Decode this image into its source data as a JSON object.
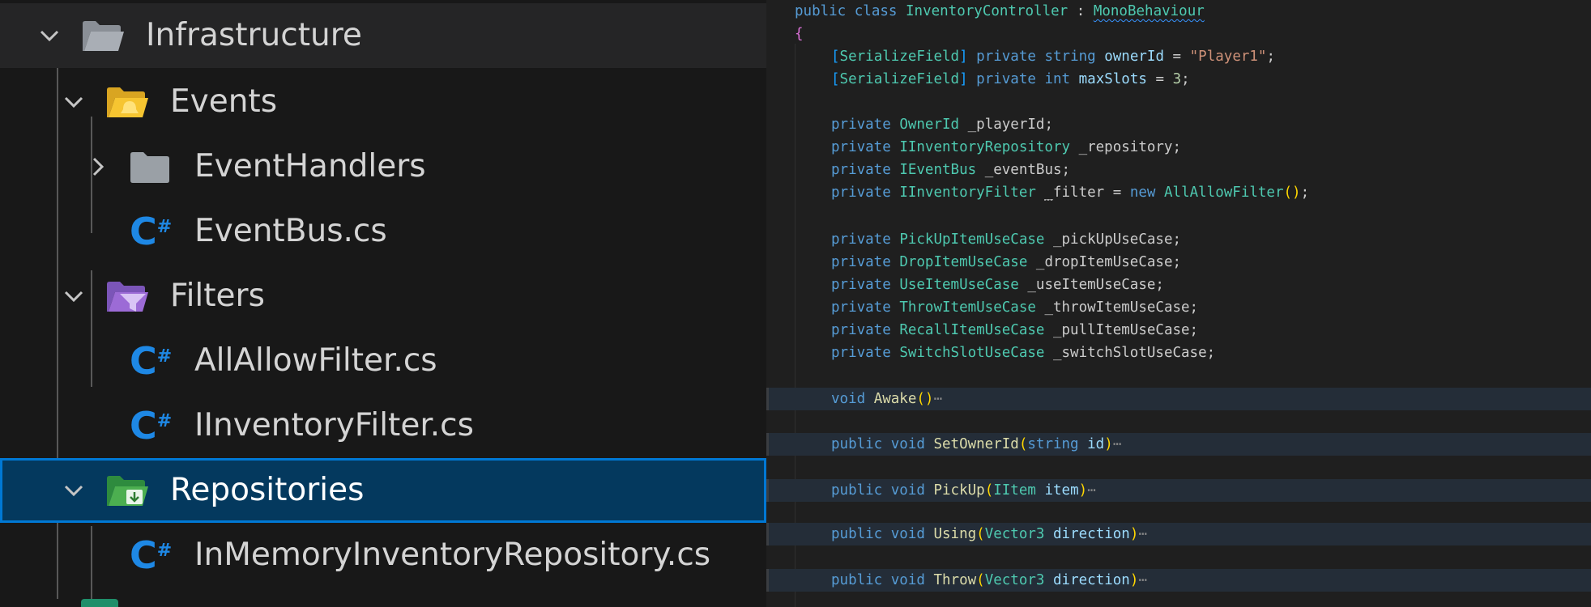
{
  "explorer": {
    "infrastructure": "Infrastructure",
    "events": "Events",
    "event_handlers": "EventHandlers",
    "event_bus": "EventBus.cs",
    "filters": "Filters",
    "all_allow_filter": "AllAllowFilter.cs",
    "iinventory_filter": "IInventoryFilter.cs",
    "repositories": "Repositories",
    "in_memory_repo": "InMemoryInventoryRepository.cs",
    "cs_glyph": "C",
    "cs_hash": "#"
  },
  "editor": {
    "l1": {
      "kw1": "public",
      "kw2": "class",
      "name": "InventoryController",
      "colon": ":",
      "base": "MonoBehaviour"
    },
    "l2": {
      "brace": "{"
    },
    "l3": {
      "b1": "[",
      "attr": "SerializeField",
      "b2": "]",
      "kw": "private",
      "type": "string",
      "name": "ownerId",
      "eq": "=",
      "val": "\"Player1\"",
      "semi": ";"
    },
    "l4": {
      "b1": "[",
      "attr": "SerializeField",
      "b2": "]",
      "kw": "private",
      "type": "int",
      "name": "maxSlots",
      "eq": "=",
      "val": "3",
      "semi": ";"
    },
    "l6": {
      "kw": "private",
      "type": "OwnerId",
      "name": "_playerId;"
    },
    "l7": {
      "kw": "private",
      "type": "IInventoryRepository",
      "name": "_repository;"
    },
    "l8": {
      "kw": "private",
      "type": "IEventBus",
      "name": "_eventBus;"
    },
    "l9": {
      "kw": "private",
      "type": "IInventoryFilter",
      "u": "_",
      "name": "filter",
      "eq": "=",
      "kw2": "new",
      "ctor": "AllAllowFilter",
      "paren": "()",
      "semi": ";"
    },
    "l11": {
      "kw": "private",
      "type": "PickUpItemUseCase",
      "name": "_pickUpUseCase;"
    },
    "l12": {
      "kw": "private",
      "type": "DropItemUseCase",
      "name": "_dropItemUseCase;"
    },
    "l13": {
      "kw": "private",
      "type": "UseItemUseCase",
      "name": "_useItemUseCase;"
    },
    "l14": {
      "kw": "private",
      "type": "ThrowItemUseCase",
      "name": "_throwItemUseCase;"
    },
    "l15": {
      "kw": "private",
      "type": "RecallItemUseCase",
      "name": "_pullItemUseCase;"
    },
    "l16": {
      "kw": "private",
      "type": "SwitchSlotUseCase",
      "name": "_switchSlotUseCase;"
    },
    "m1": {
      "kw": "void",
      "fn": "Awake",
      "paren": "()",
      "ell": "⋯"
    },
    "m2": {
      "kw1": "public",
      "kw2": "void",
      "fn": "SetOwnerId",
      "po": "(",
      "ptype": "string",
      "pname": "id",
      "pc": ")",
      "ell": "⋯"
    },
    "m3": {
      "kw1": "public",
      "kw2": "void",
      "fn": "PickUp",
      "po": "(",
      "ptype": "IItem",
      "pname": "item",
      "pc": ")",
      "ell": "⋯"
    },
    "m4": {
      "kw1": "public",
      "kw2": "void",
      "fn": "Using",
      "po": "(",
      "ptype": "Vector3",
      "pname": "direction",
      "pc": ")",
      "ell": "⋯"
    },
    "m5": {
      "kw1": "public",
      "kw2": "void",
      "fn": "Throw",
      "po": "(",
      "ptype": "Vector3",
      "pname": "direction",
      "pc": ")",
      "ell": "⋯"
    }
  },
  "colors": {
    "selection": "#04395e",
    "focus_outline": "#0078d4",
    "csharp_icon": "#1e88e5",
    "events_folder": "#f6c531",
    "filters_folder": "#9c6bd6",
    "repositories_folder": "#4caf50"
  }
}
